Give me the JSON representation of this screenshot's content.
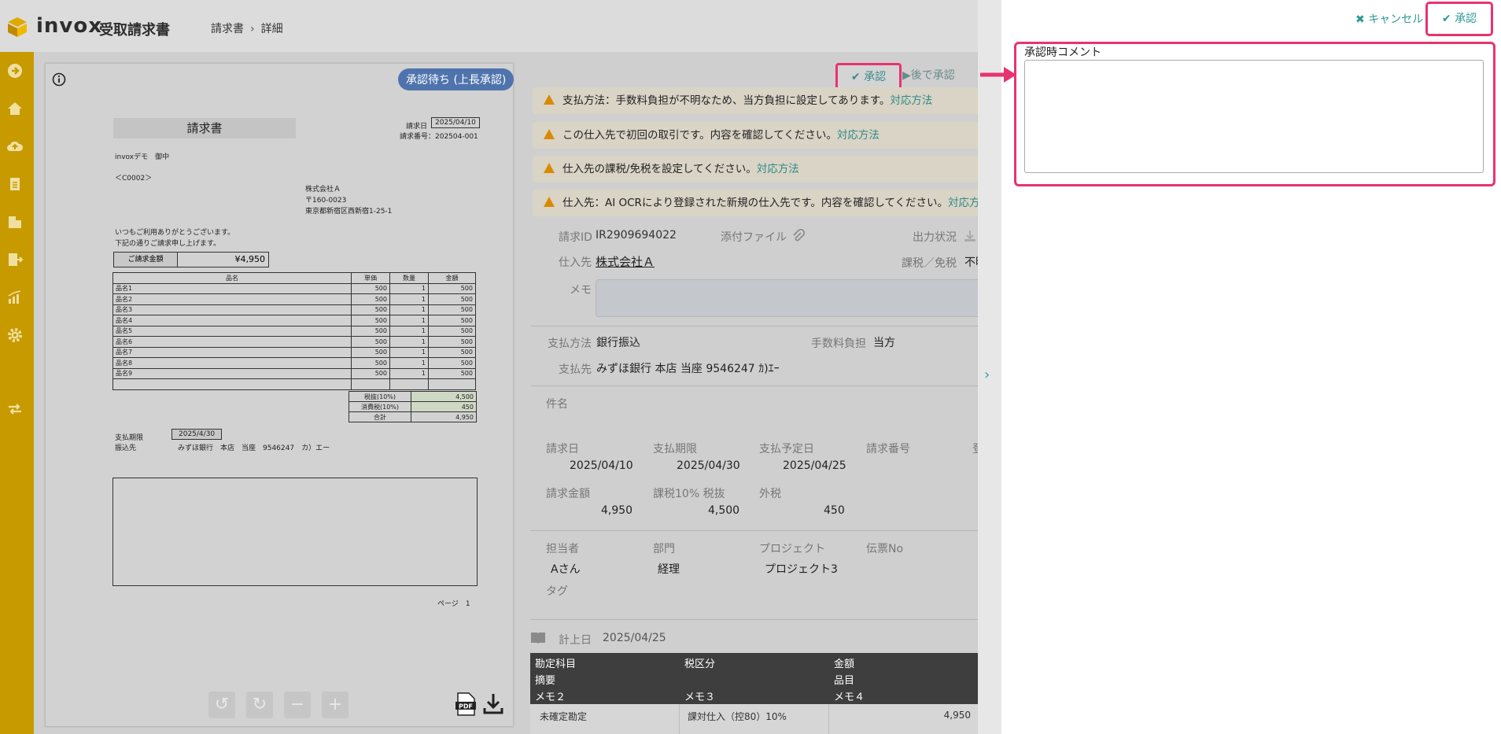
{
  "header": {
    "logo_text": "invox",
    "logo_sub": "受取請求書",
    "breadcrumb": [
      "請求書",
      "詳細"
    ]
  },
  "sidebar": {
    "icons": [
      "login-icon",
      "home-icon",
      "cloud-upload-icon",
      "document-icon",
      "building-icon",
      "export-icon",
      "chart-icon",
      "gear-icon",
      "transfer-icon"
    ]
  },
  "document": {
    "status_badge": "承認待ち (上長承認)",
    "title": "請求書",
    "issue_date_label": "請求日",
    "issue_date": "2025/04/10",
    "invoice_no_label": "請求番号：202504-001",
    "addressee": "invoxデモ　御中",
    "code": "＜C0002＞",
    "company": "株式会社Ａ",
    "postal": "〒160-0023",
    "address": "東京都新宿区西新宿1-25-1",
    "greeting1": "いつもご利用ありがとうございます。",
    "greeting2": "下記の通りご請求申し上げます。",
    "amount_label": "ご請求金額",
    "amount": "¥4,950",
    "table_headers": [
      "品名",
      "単価",
      "数量",
      "金額"
    ],
    "items": [
      {
        "name": "品名1",
        "price": "500",
        "qty": "1",
        "amount": "500"
      },
      {
        "name": "品名2",
        "price": "500",
        "qty": "1",
        "amount": "500"
      },
      {
        "name": "品名3",
        "price": "500",
        "qty": "1",
        "amount": "500"
      },
      {
        "name": "品名4",
        "price": "500",
        "qty": "1",
        "amount": "500"
      },
      {
        "name": "品名5",
        "price": "500",
        "qty": "1",
        "amount": "500"
      },
      {
        "name": "品名6",
        "price": "500",
        "qty": "1",
        "amount": "500"
      },
      {
        "name": "品名7",
        "price": "500",
        "qty": "1",
        "amount": "500"
      },
      {
        "name": "品名8",
        "price": "500",
        "qty": "1",
        "amount": "500"
      },
      {
        "name": "品名9",
        "price": "500",
        "qty": "1",
        "amount": "500"
      }
    ],
    "totals": [
      {
        "label": "税抜(10%)",
        "value": "4,500"
      },
      {
        "label": "消費税(10%)",
        "value": "450"
      },
      {
        "label": "合計",
        "value": "4,950"
      }
    ],
    "due_label": "支払期限",
    "due_date": "2025/4/30",
    "bank_label": "振込先",
    "bank": "みずほ銀行　本店　当座　9546247　カ）エー",
    "page_label": "ページ　1"
  },
  "toolbar": {
    "approve_label": "✔ 承認",
    "later_label": "後で承認"
  },
  "warnings": [
    {
      "text": "支払方法：手数料負担が不明なため、当方負担に設定してあります。",
      "link": "対応方法"
    },
    {
      "text": "この仕入先で初回の取引です。内容を確認してください。",
      "link": "対応方法"
    },
    {
      "text": "仕入先の課税/免税を設定してください。",
      "link": "対応方法"
    },
    {
      "text": "仕入先：AI OCRにより登録された新規の仕入先です。内容を確認してください。",
      "link": "対応方"
    }
  ],
  "details": {
    "invoice_id_label": "請求ID",
    "invoice_id": "IR2909694022",
    "attachment_label": "添付ファイル",
    "output_label": "出力状況",
    "vendor_label": "仕入先",
    "vendor": "株式会社Ａ",
    "tax_label": "課税／免税",
    "tax_value": "不明",
    "memo_label": "メモ",
    "pay_method_label": "支払方法",
    "pay_method": "銀行振込",
    "fee_label": "手数料負担",
    "fee": "当方",
    "pay_to_label": "支払先",
    "pay_to": "みずほ銀行 本店 当座 9546247 ｶ)ｴｰ",
    "subject_label": "件名",
    "invoice_date_label": "請求日",
    "invoice_date": "2025/04/10",
    "due_label": "支払期限",
    "due": "2025/04/30",
    "planned_label": "支払予定日",
    "planned": "2025/04/25",
    "number_label": "請求番号",
    "reg_label": "登",
    "amount_label": "請求金額",
    "amount": "4,950",
    "taxable_label": "課税10% 税抜",
    "taxable": "4,500",
    "outer_tax_label": "外税",
    "outer_tax": "450",
    "person_label": "担当者",
    "person": "Aさん",
    "dept_label": "部門",
    "dept": "経理",
    "project_label": "プロジェクト",
    "project": "プロジェクト3",
    "slip_label": "伝票No",
    "tag_label": "タグ",
    "booking_label": "計上日",
    "booking_date": "2025/04/25"
  },
  "accounts": {
    "headers_row1": [
      "勘定科目",
      "税区分",
      "金額"
    ],
    "headers_row2": [
      "摘要",
      "",
      "品目"
    ],
    "headers_row3": [
      "メモ２",
      "メモ３",
      "メモ４"
    ],
    "row": {
      "account": "未確定勘定",
      "tax": "課対仕入（控80）10%",
      "amount": "4,950"
    }
  },
  "panel": {
    "cancel_label": "✖ キャンセル",
    "approve_label": "✔ 承認",
    "comment_label": "承認時コメント",
    "comment_value": ""
  },
  "colors": {
    "sidebar": "#c79a00",
    "accent": "#2b9a96",
    "highlight": "#e9336f",
    "warning": "#d98a00",
    "badge": "#4f74ad"
  }
}
